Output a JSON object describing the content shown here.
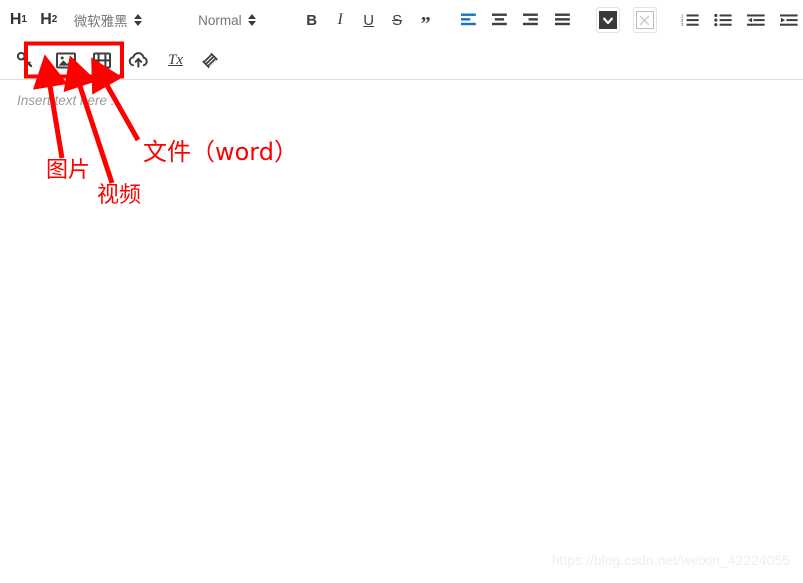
{
  "app": {
    "name": "rich-text-editor"
  },
  "toolbar": {
    "row1": {
      "heading1": "H",
      "heading1_sub": "1",
      "heading2": "H",
      "heading2_sub": "2",
      "font_family_value": "微软雅黑",
      "font_size_value": "Normal",
      "bold": "B",
      "italic": "I",
      "underline": "U",
      "strike": "S",
      "blockquote": "”",
      "align_left": "align-left",
      "align_center": "align-center",
      "align_right": "align-right",
      "align_justify": "align-justify",
      "text_color": "text-color",
      "background_color": "background-color",
      "ordered_list": "ordered-list",
      "bullet_list": "bullet-list",
      "outdent": "outdent",
      "indent": "indent"
    },
    "row2": {
      "link": "link",
      "image": "image",
      "video": "video",
      "file_upload": "file-upload",
      "clear_format": "Tx",
      "format_brush": "format-brush"
    }
  },
  "editor": {
    "placeholder": "Insert text here ..."
  },
  "annotations": {
    "image_label": "图片",
    "video_label": "视频",
    "file_label": "文件（word）",
    "highlight_box": "image-video-file-group",
    "color": "#fe0000"
  },
  "watermark": {
    "text": "https://blog.csdn.net/weixin_42224055"
  },
  "colors": {
    "accent_blue": "#1673c8",
    "icon_gray": "#3f3f3f",
    "muted_gray": "#757575",
    "annotation_red": "#fe0000",
    "watermark_gray": "#eeeeee"
  }
}
